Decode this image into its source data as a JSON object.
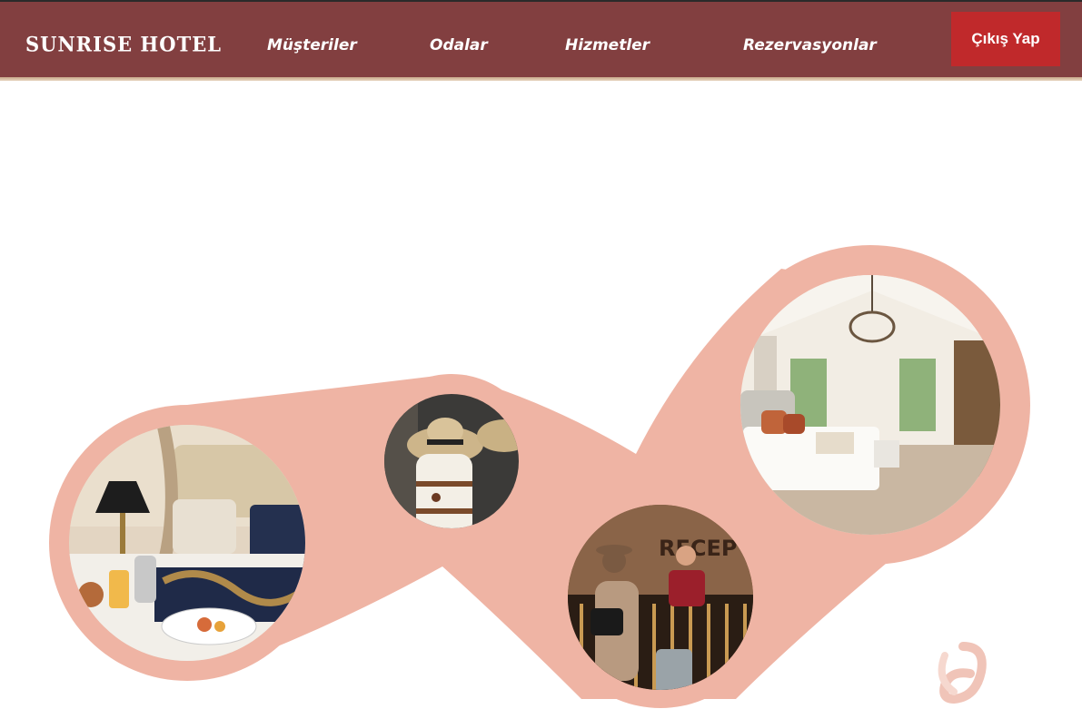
{
  "header": {
    "brand": "SUNRISE HOTEL",
    "nav": [
      "Müşteriler",
      "Odalar",
      "Hizmetler",
      "Rezervasyonlar"
    ],
    "logout_label": "Çıkış Yap"
  },
  "hero": {
    "photos": [
      {
        "subject": "breakfast tray on hotel bed"
      },
      {
        "subject": "straw hats on coat rack"
      },
      {
        "subject": "guests at hotel reception desk",
        "sign_text": "RECEP"
      },
      {
        "subject": "bright hotel bedroom with chandelier"
      }
    ]
  },
  "colors": {
    "header_bg": "#823f40",
    "logout_bg": "#c0292b",
    "blob": "#efb4a4",
    "page_bg": "#ffffff"
  }
}
